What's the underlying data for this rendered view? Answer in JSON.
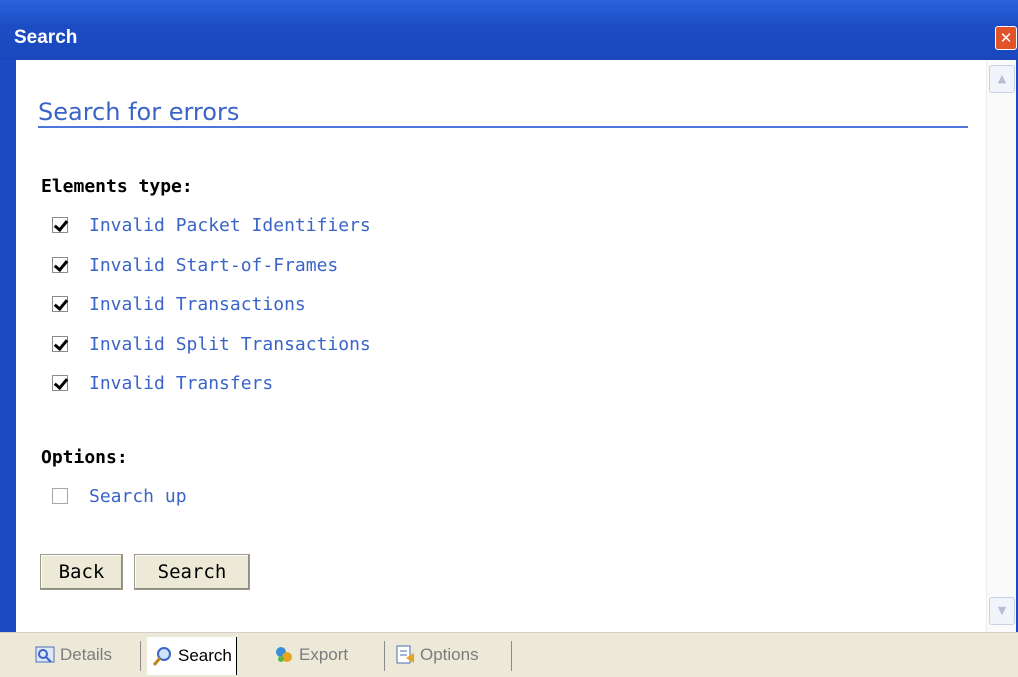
{
  "window": {
    "title": "Search",
    "close_symbol": "✕"
  },
  "page": {
    "heading": "Search for errors",
    "elements_label": "Elements type:",
    "element_types": [
      {
        "label": "Invalid Packet Identifiers",
        "checked": true
      },
      {
        "label": "Invalid Start-of-Frames",
        "checked": true
      },
      {
        "label": "Invalid Transactions",
        "checked": true
      },
      {
        "label": "Invalid Split Transactions",
        "checked": true
      },
      {
        "label": "Invalid Transfers",
        "checked": true
      }
    ],
    "options_label": "Options:",
    "options": [
      {
        "label": "Search up",
        "checked": false
      }
    ],
    "buttons": {
      "back": "Back",
      "search": "Search"
    }
  },
  "tabs": [
    {
      "label": "Details",
      "icon": "details-icon",
      "active": false
    },
    {
      "label": "Search",
      "icon": "magnifier-icon",
      "active": true
    },
    {
      "label": "Export",
      "icon": "export-icon",
      "active": false
    },
    {
      "label": "Options",
      "icon": "options-icon",
      "active": false
    }
  ],
  "colors": {
    "titlebar": "#1c4cc4",
    "link_blue": "#3a64c8",
    "close": "#e2532a"
  }
}
